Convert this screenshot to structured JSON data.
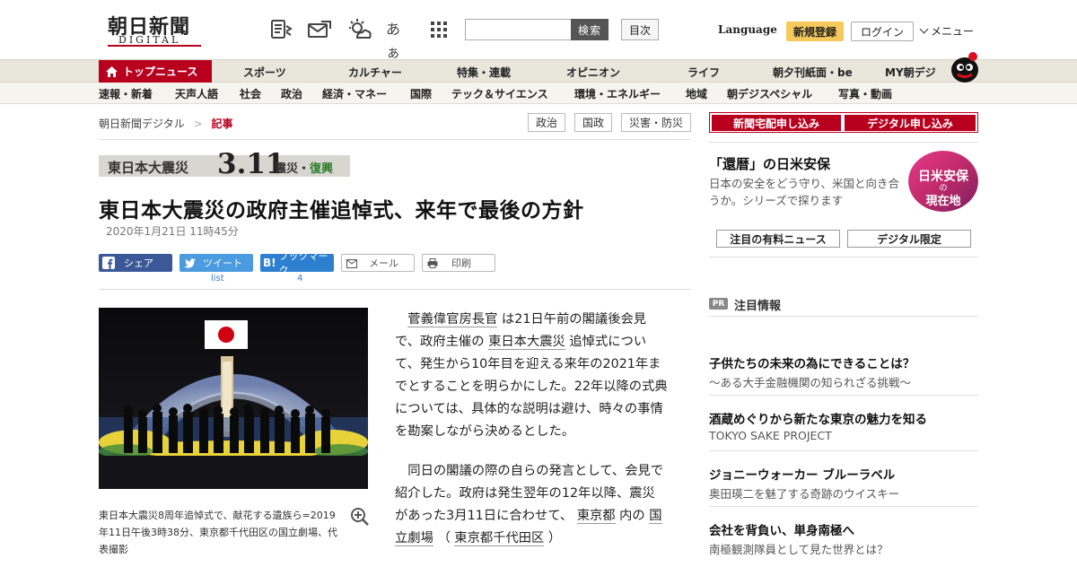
{
  "header": {
    "logo_main": "朝日新聞",
    "logo_sub": "DIGITAL",
    "icons": [
      "newspaper-icon",
      "mail-icon",
      "weather-icon",
      "font-size-icon",
      "grid-icon"
    ],
    "font_size_glyph": "あぁ",
    "search_placeholder": "",
    "search_label": "検索",
    "toc_label": "目次",
    "language_label": "Language",
    "register_label": "新規登録",
    "login_label": "ログイン",
    "menu_label": "メニュー"
  },
  "nav_primary": {
    "top_news": "トップニュース",
    "items": [
      "スポーツ",
      "カルチャー",
      "特集・連載",
      "オピニオン",
      "ライフ",
      "朝夕刊紙面・be",
      "MY朝デジ"
    ]
  },
  "nav_secondary": {
    "items": [
      "速報・新着",
      "天声人語",
      "社会",
      "政治",
      "経済・マネー",
      "国際",
      "テック＆サイエンス",
      "環境・エネルギー",
      "地域",
      "朝デジスペシャル",
      "写真・動画"
    ]
  },
  "breadcrumb": {
    "home": "朝日新聞デジタル",
    "separator": ">",
    "current": "記事"
  },
  "tags": [
    "政治",
    "国政",
    "災害・防災"
  ],
  "banner": {
    "title": "東日本大震災",
    "number": "3.11",
    "sub_a": "震災・",
    "sub_b": "復興"
  },
  "article": {
    "title": "東日本大震災の政府主催追悼式、来年で最後の方針",
    "date": "2020年1月21日 11時45分",
    "share": {
      "facebook": "シェア",
      "twitter": "ツイート",
      "hatena": "ブックマーク",
      "mail": "メール",
      "print": "印刷",
      "twitter_count": "list",
      "hatena_count": "4"
    },
    "caption": "東日本大震災8周年追悼式で、献花する遺族ら=2019年11日午後3時38分、東京都千代田区の国立劇場、代表撮影",
    "p1_link1": "菅義偉官房長官",
    "p1_a": "は21日午前の閣議後会見で、政府主催の",
    "p1_link2": "東日本大震災",
    "p1_b": "追悼式について、発生から10年目を迎える来年の2021年までとすることを明らかにした。22年以降の式典については、具体的な説明は避け、時々の事情を勘案しながら決めるとした。",
    "p2_a": "同日の閣議の際の自らの発言として、会見で紹介した。政府は発生翌年の12年以降、震災があった3月11日に合わせて、",
    "p2_link1": "東京都",
    "p2_b": "内の",
    "p2_link2": "国立劇場",
    "p2_c": "（",
    "p2_link3": "東京都千代田区",
    "p2_d": "）"
  },
  "sidebar": {
    "subscribe_paper": "新聞宅配申し込み",
    "subscribe_digital": "デジタル申し込み",
    "feature_title": "「還暦」の日米安保",
    "feature_desc": "日本の安全をどう守り、米国と向き合うか。シリーズで探ります",
    "feature_img_line1": "日米安保",
    "feature_img_line2": "の",
    "feature_img_line3": "現在地",
    "tab_premium": "注目の有料ニュース",
    "tab_digital": "デジタル限定",
    "pr_badge": "PR",
    "pr_title": "注目情報",
    "pr_items": [
      {
        "headline": "子供たちの未来の為にできることは？",
        "sub": "～ある大手金融機関の知られざる挑戦～"
      },
      {
        "headline": "酒蔵めぐりから新たな東京の魅力を知る",
        "sub": "TOKYO SAKE PROJECT"
      },
      {
        "headline": "ジョニーウォーカー ブルーラベル",
        "sub": "奥田瑛二を魅了する奇跡のウイスキー"
      },
      {
        "headline": "会社を背負い、単身南極へ",
        "sub": "南極観測隊員として見た世界とは？"
      }
    ]
  },
  "colors": {
    "brand_red": "#b8001e",
    "nav_bg": "#e9e6dc",
    "facebook": "#3b5998",
    "twitter": "#4a9bdf",
    "hatena": "#2d7fd0",
    "register": "#f5c95a"
  }
}
